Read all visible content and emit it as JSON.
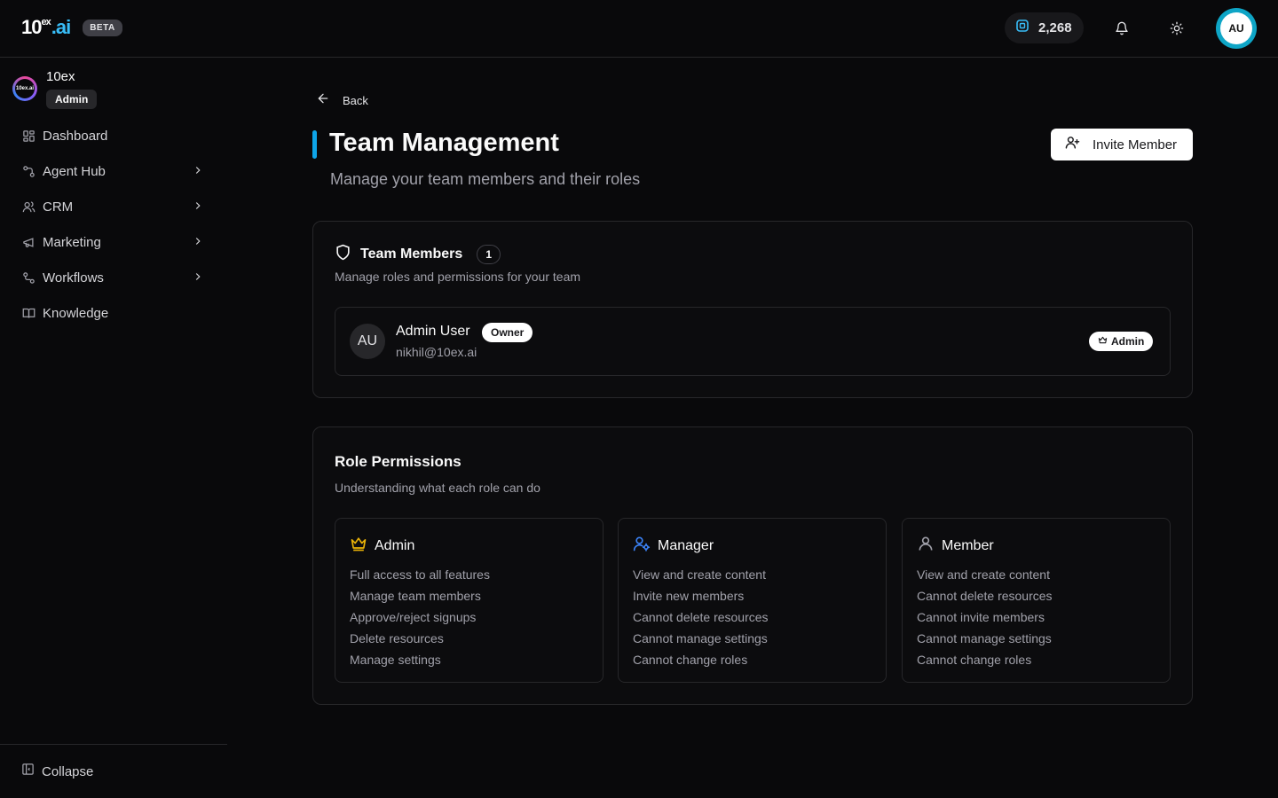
{
  "header": {
    "logo_main": "10",
    "logo_sup": "ex",
    "logo_suffix": ".ai",
    "beta": "BETA",
    "credits": "2,268",
    "avatar_initials": "AU"
  },
  "sidebar": {
    "org_name": "10ex",
    "org_logo_text": "10ex.ai",
    "org_role": "Admin",
    "items": [
      {
        "label": "Dashboard",
        "icon": "dashboard-icon"
      },
      {
        "label": "Agent Hub",
        "icon": "agent-hub-icon"
      },
      {
        "label": "CRM",
        "icon": "users-icon"
      },
      {
        "label": "Marketing",
        "icon": "megaphone-icon"
      },
      {
        "label": "Workflows",
        "icon": "workflow-icon"
      },
      {
        "label": "Knowledge",
        "icon": "book-icon"
      }
    ],
    "collapse": "Collapse"
  },
  "main": {
    "back": "Back",
    "title": "Team Management",
    "subtitle": "Manage your team members and their roles",
    "invite_button": "Invite Member",
    "team_members": {
      "title": "Team Members",
      "count": "1",
      "subtitle": "Manage roles and permissions for your team",
      "members": [
        {
          "initials": "AU",
          "name": "Admin User",
          "badge": "Owner",
          "email": "nikhil@10ex.ai",
          "role": "Admin"
        }
      ]
    },
    "role_permissions": {
      "title": "Role Permissions",
      "subtitle": "Understanding what each role can do",
      "roles": [
        {
          "name": "Admin",
          "icon": "crown-icon",
          "color": "#eab308",
          "permissions": [
            "Full access to all features",
            "Manage team members",
            "Approve/reject signups",
            "Delete resources",
            "Manage settings"
          ]
        },
        {
          "name": "Manager",
          "icon": "user-cog-icon",
          "color": "#3b82f6",
          "permissions": [
            "View and create content",
            "Invite new members",
            "Cannot delete resources",
            "Cannot manage settings",
            "Cannot change roles"
          ]
        },
        {
          "name": "Member",
          "icon": "user-icon",
          "color": "#a1a1aa",
          "permissions": [
            "View and create content",
            "Cannot delete resources",
            "Cannot invite members",
            "Cannot manage settings",
            "Cannot change roles"
          ]
        }
      ]
    }
  },
  "colors": {
    "accent": "#0ea5e9",
    "background": "#09090b",
    "admin_gold": "#eab308",
    "manager_blue": "#3b82f6"
  }
}
